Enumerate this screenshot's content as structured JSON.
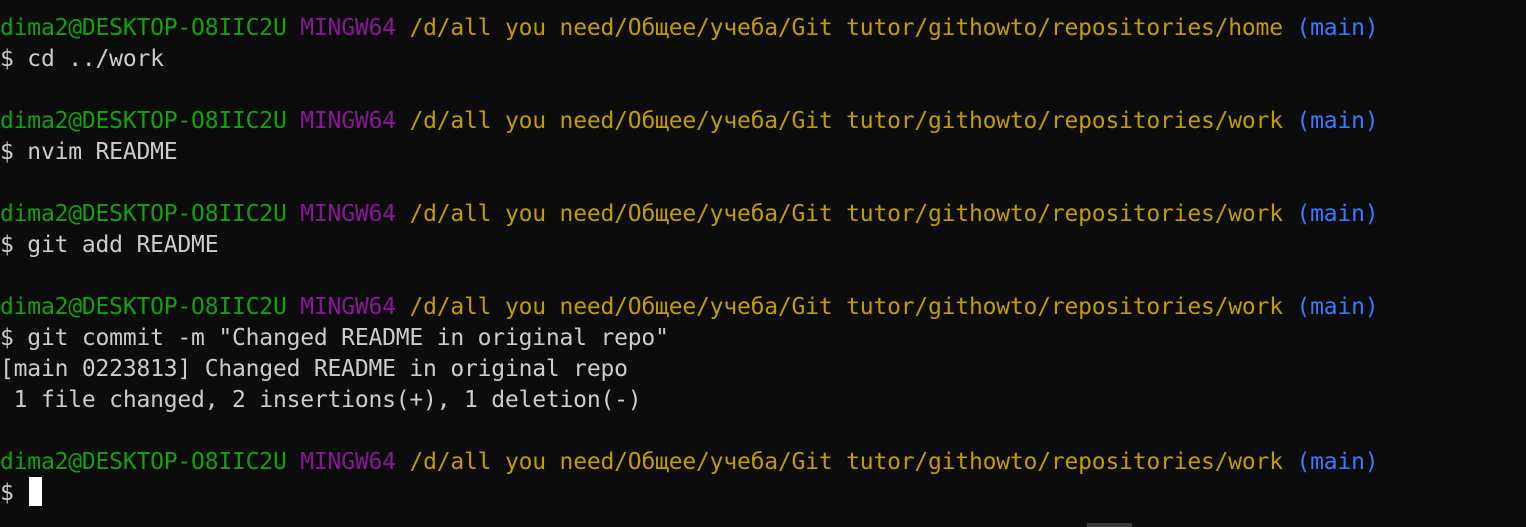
{
  "blocks": [
    {
      "prompt": {
        "user": "dima2@DESKTOP-O8IIC2U",
        "host": "MINGW64",
        "path": "/d/all you need/Общее/учеба/Git tutor/githowto/repositories/home",
        "branch": "(main)"
      },
      "command": "$ cd ../work",
      "output": []
    },
    {
      "prompt": {
        "user": "dima2@DESKTOP-O8IIC2U",
        "host": "MINGW64",
        "path": "/d/all you need/Общее/учеба/Git tutor/githowto/repositories/work",
        "branch": "(main)"
      },
      "command": "$ nvim README",
      "output": []
    },
    {
      "prompt": {
        "user": "dima2@DESKTOP-O8IIC2U",
        "host": "MINGW64",
        "path": "/d/all you need/Общее/учеба/Git tutor/githowto/repositories/work",
        "branch": "(main)"
      },
      "command": "$ git add README",
      "output": []
    },
    {
      "prompt": {
        "user": "dima2@DESKTOP-O8IIC2U",
        "host": "MINGW64",
        "path": "/d/all you need/Общее/учеба/Git tutor/githowto/repositories/work",
        "branch": "(main)"
      },
      "command": "$ git commit -m \"Changed README in original repo\"",
      "output": [
        "[main 0223813] Changed README in original repo",
        " 1 file changed, 2 insertions(+), 1 deletion(-)"
      ]
    },
    {
      "prompt": {
        "user": "dima2@DESKTOP-O8IIC2U",
        "host": "MINGW64",
        "path": "/d/all you need/Общее/учеба/Git tutor/githowto/repositories/work",
        "branch": "(main)"
      },
      "command": "$ ",
      "output": []
    }
  ],
  "colors": {
    "background": "#0c0c0c",
    "user": "#13a10e",
    "host": "#881798",
    "path": "#c19c00",
    "branch": "#3b78ff",
    "text": "#cccccc",
    "cursor": "#ffffff"
  }
}
